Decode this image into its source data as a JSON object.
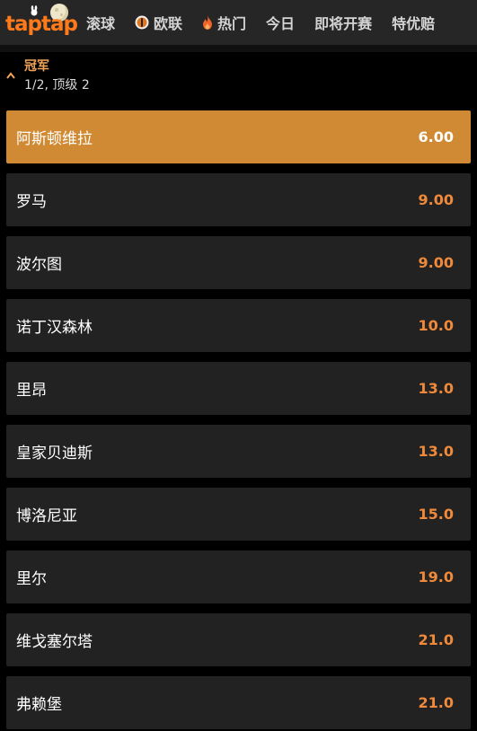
{
  "brand": {
    "logo_text": "taptap",
    "accent": "#ff7a1a"
  },
  "nav": {
    "items": [
      {
        "label": "滚球",
        "icon": ""
      },
      {
        "label": "欧联",
        "icon": "europa-league-icon"
      },
      {
        "label": "热门",
        "icon": "flame-icon"
      },
      {
        "label": "今日",
        "icon": ""
      },
      {
        "label": "即将开赛",
        "icon": ""
      },
      {
        "label": "特优赔",
        "icon": ""
      }
    ]
  },
  "section": {
    "title": "冠军",
    "subtitle": "1/2, 顶级 2",
    "title_color": "#f0a458"
  },
  "selections": [
    {
      "name": "阿斯顿维拉",
      "odds": "6.00",
      "selected": true
    },
    {
      "name": "罗马",
      "odds": "9.00"
    },
    {
      "name": "波尔图",
      "odds": "9.00"
    },
    {
      "name": "诺丁汉森林",
      "odds": "10.0"
    },
    {
      "name": "里昂",
      "odds": "13.0"
    },
    {
      "name": "皇家贝迪斯",
      "odds": "13.0"
    },
    {
      "name": "博洛尼亚",
      "odds": "15.0"
    },
    {
      "name": "里尔",
      "odds": "19.0"
    },
    {
      "name": "维戈塞尔塔",
      "odds": "21.0"
    },
    {
      "name": "弗赖堡",
      "odds": "21.0"
    }
  ],
  "colors": {
    "selected_bg": "#d08a33",
    "row_bg": "#222222",
    "odds": "#f08a3a"
  }
}
